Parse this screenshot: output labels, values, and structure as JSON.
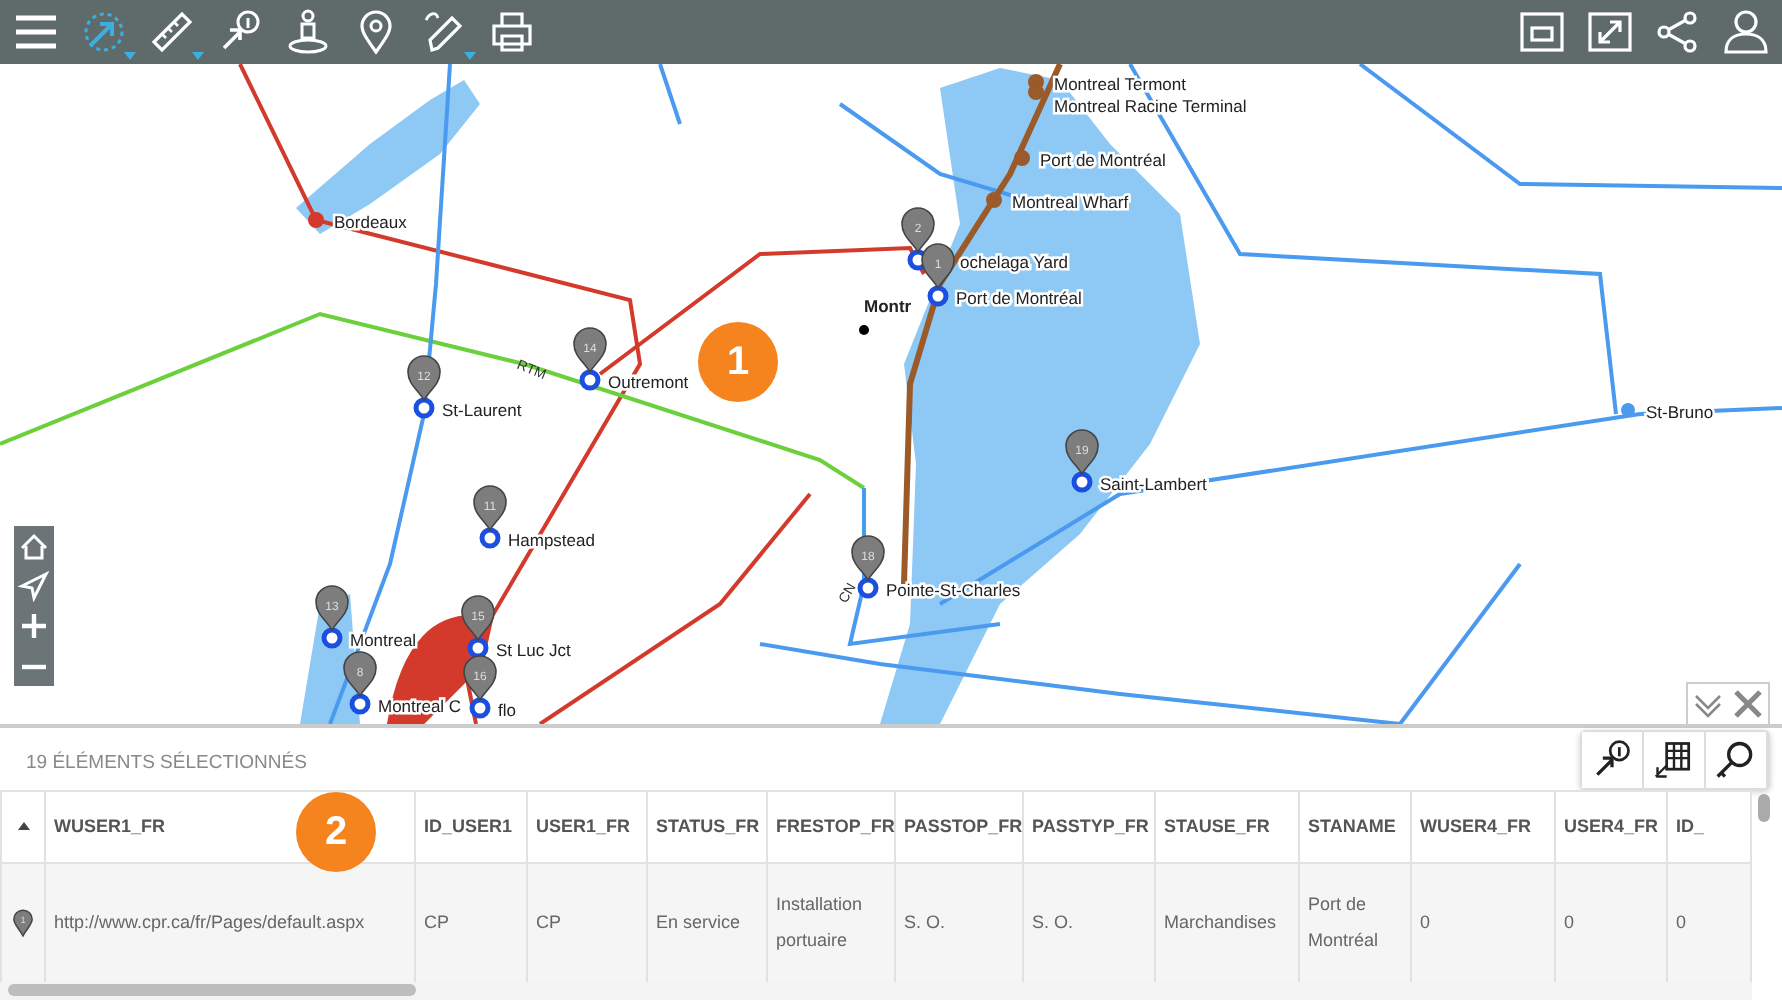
{
  "toolbar": {
    "left_tools": [
      {
        "kind": "menu",
        "selected": false,
        "has_menu": false
      },
      {
        "kind": "select",
        "selected": true,
        "has_menu": true
      },
      {
        "kind": "measure",
        "selected": false,
        "has_menu": true
      },
      {
        "kind": "identify",
        "selected": false,
        "has_menu": false
      },
      {
        "kind": "streetview",
        "selected": false,
        "has_menu": false
      },
      {
        "kind": "location",
        "selected": false,
        "has_menu": false
      },
      {
        "kind": "draw",
        "selected": false,
        "has_menu": true
      },
      {
        "kind": "print",
        "selected": false,
        "has_menu": false
      }
    ],
    "right_tools": [
      {
        "kind": "window"
      },
      {
        "kind": "fullscreen"
      },
      {
        "kind": "share"
      },
      {
        "kind": "user"
      }
    ]
  },
  "map": {
    "stations": [
      {
        "name": "Bordeaux",
        "kind": "terminal"
      },
      {
        "name": "Montreal Termont",
        "kind": "port"
      },
      {
        "name": "Montreal Racine Terminal",
        "kind": "port"
      },
      {
        "name": "Port de Montréal",
        "kind": "port"
      },
      {
        "name": "Montreal Wharf",
        "kind": "port"
      },
      {
        "name": "ochelaga Yard",
        "kind": "station",
        "pin": "2"
      },
      {
        "name": "Port de Montréal",
        "kind": "station",
        "pin": "1"
      },
      {
        "name": "Montr",
        "kind": "city"
      },
      {
        "name": "Outremont",
        "kind": "station",
        "pin": "14"
      },
      {
        "name": "St-Laurent",
        "kind": "station",
        "pin": "12"
      },
      {
        "name": "Saint-Lambert",
        "kind": "station",
        "pin": "19"
      },
      {
        "name": "St-Bruno",
        "kind": "terminal_blue"
      },
      {
        "name": "Hampstead",
        "kind": "station",
        "pin": "11"
      },
      {
        "name": "Pointe-St-Charles",
        "kind": "station",
        "pin": "18"
      },
      {
        "name": "Montreal",
        "kind": "station",
        "pin": "13"
      },
      {
        "name": "St Luc Jct",
        "kind": "station",
        "pin": "15"
      },
      {
        "name": "Montreal C",
        "kind": "station",
        "pin": "8"
      },
      {
        "name": "flo",
        "kind": "station",
        "pin": "16"
      }
    ],
    "line_labels": [
      "RTM",
      "CN"
    ],
    "controls": [
      {
        "kind": "home"
      },
      {
        "kind": "locate"
      },
      {
        "kind": "zoom_in"
      },
      {
        "kind": "zoom_out"
      }
    ]
  },
  "callouts": [
    "1",
    "2"
  ],
  "selection_panel": {
    "title": "19 ÉLÉMENTS SÉLECTIONNÉS",
    "tools": [
      {
        "kind": "identify"
      },
      {
        "kind": "table"
      },
      {
        "kind": "search"
      }
    ],
    "table": {
      "marker_column": {
        "sorted": true
      },
      "columns": [
        {
          "label": "WUSER1_FR",
          "sorted": false
        },
        {
          "label": "ID_USER1",
          "sorted": false
        },
        {
          "label": "USER1_FR",
          "sorted": false
        },
        {
          "label": "STATUS_FR",
          "sorted": false
        },
        {
          "label": "FRESTOP_FR",
          "sorted": false
        },
        {
          "label": "PASSTOP_FR",
          "sorted": false
        },
        {
          "label": "PASSTYP_FR",
          "sorted": false
        },
        {
          "label": "STAUSE_FR",
          "sorted": false
        },
        {
          "label": "STANAME",
          "sorted": false
        },
        {
          "label": "WUSER4_FR",
          "sorted": false
        },
        {
          "label": "USER4_FR",
          "sorted": false
        },
        {
          "label": "ID_",
          "sorted": false
        }
      ],
      "rows": [
        {
          "pin": "1",
          "cells": [
            "http://www.cpr.ca/fr/Pages/default.aspx",
            "CP",
            "CP",
            "En service",
            "Installation portuaire",
            "S. O.",
            "S. O.",
            "Marchandises",
            "Port de Montréal",
            "0",
            "0",
            "0"
          ]
        }
      ]
    }
  }
}
